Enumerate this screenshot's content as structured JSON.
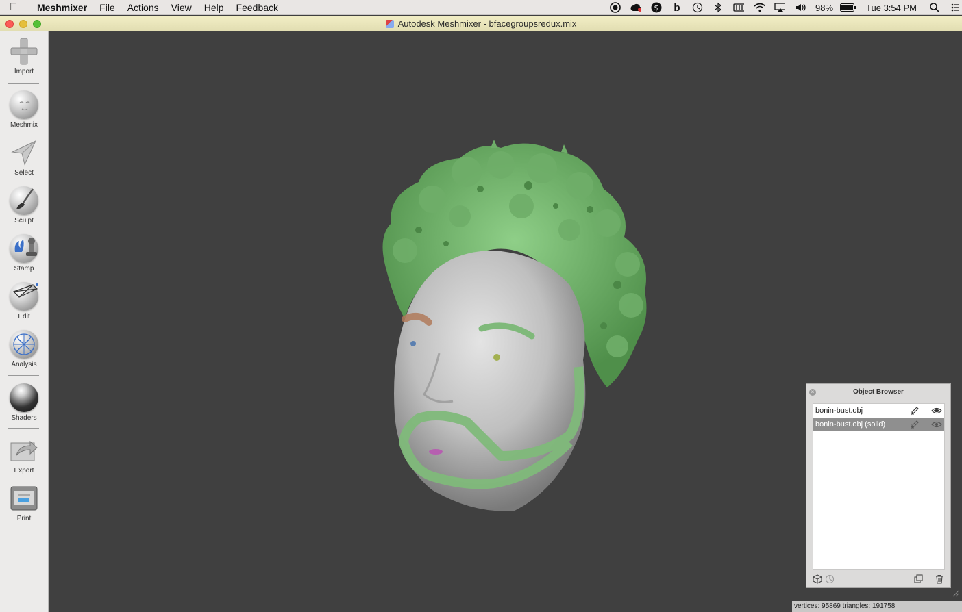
{
  "menubar": {
    "apple_icon": "apple-icon",
    "app_name": "Meshmixer",
    "items": [
      "File",
      "Actions",
      "View",
      "Help",
      "Feedback"
    ],
    "battery": "98%",
    "clock": "Tue 3:54 PM"
  },
  "window": {
    "title": "Autodesk Meshmixer - bfacegroupsredux.mix"
  },
  "toolbar": {
    "tools": [
      {
        "label": "Import",
        "icon": "plus-icon"
      },
      {
        "label": "Meshmix",
        "icon": "meshmix-sphere-icon"
      },
      {
        "label": "Select",
        "icon": "arrow-select-icon"
      },
      {
        "label": "Sculpt",
        "icon": "brush-icon"
      },
      {
        "label": "Stamp",
        "icon": "stamp-icon"
      },
      {
        "label": "Edit",
        "icon": "edit-wireframe-icon"
      },
      {
        "label": "Analysis",
        "icon": "analysis-mesh-icon"
      },
      {
        "label": "Shaders",
        "icon": "shader-sphere-icon"
      },
      {
        "label": "Export",
        "icon": "export-icon"
      },
      {
        "label": "Print",
        "icon": "printer-icon"
      }
    ]
  },
  "object_browser": {
    "title": "Object Browser",
    "items": [
      {
        "name": "bonin-bust.obj",
        "selected": false
      },
      {
        "name": "bonin-bust.obj (solid)",
        "selected": true
      }
    ]
  },
  "status": {
    "stats": "vertices: 95869 triangles: 191758"
  },
  "colors": {
    "viewport_bg": "#404040",
    "facegroup_green": "#7fb97a",
    "mesh_gray": "#bdbdbd"
  }
}
